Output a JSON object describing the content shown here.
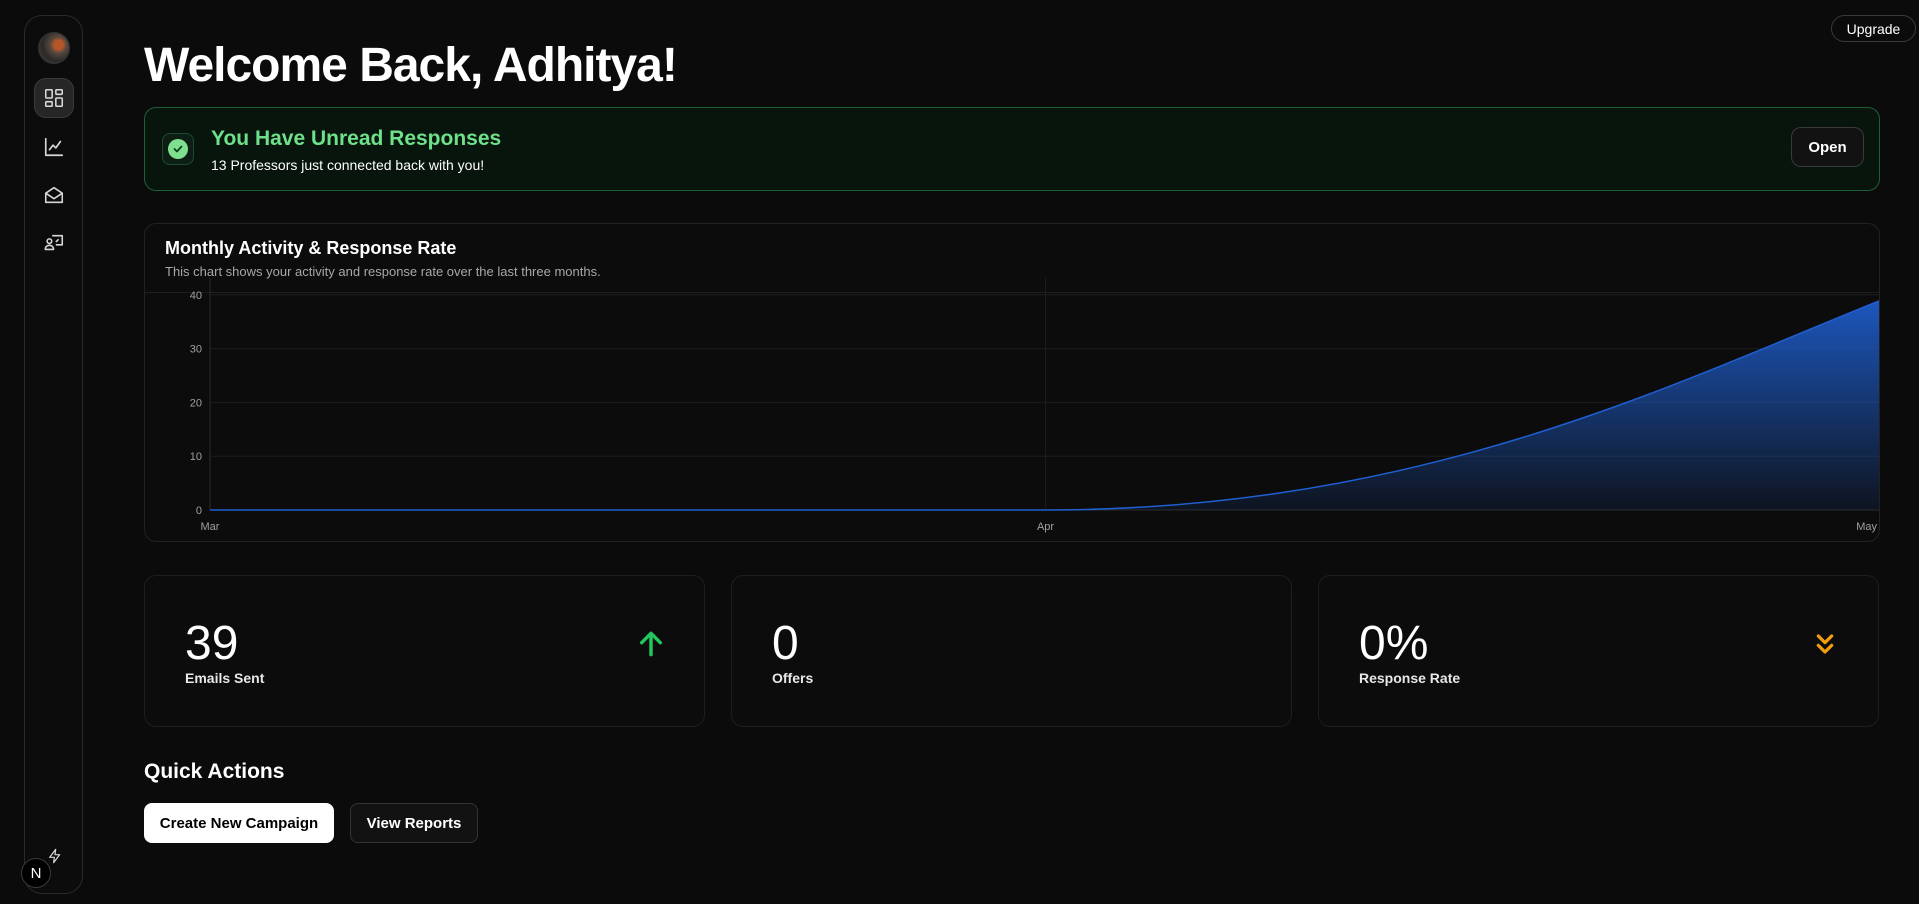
{
  "header": {
    "title": "Welcome Back, Adhitya!",
    "upgrade_label": "Upgrade"
  },
  "sidebar": {
    "items": [
      {
        "name": "dashboard",
        "icon": "dashboard-icon",
        "active": true
      },
      {
        "name": "analytics",
        "icon": "line-chart-icon",
        "active": false
      },
      {
        "name": "inbox",
        "icon": "mail-open-icon",
        "active": false
      },
      {
        "name": "professors",
        "icon": "presentation-user-icon",
        "active": false
      }
    ],
    "footer_icon": "bolt-icon",
    "badge_letter": "N"
  },
  "alert": {
    "title": "You Have Unread Responses",
    "message": "13 Professors just connected back with you!",
    "button_label": "Open",
    "accent_color": "#6ee08a"
  },
  "chart": {
    "title": "Monthly Activity & Response Rate",
    "description": "This chart shows your activity and response rate over the last three months."
  },
  "chart_data": {
    "type": "area",
    "x": [
      "Mar",
      "Apr",
      "May"
    ],
    "series": [
      {
        "values": [
          0,
          0,
          39
        ],
        "color": "#1f5fd1"
      }
    ],
    "y_ticks": [
      0,
      10,
      20,
      30,
      40
    ],
    "ylim": [
      0,
      42
    ],
    "grid": true
  },
  "stats": [
    {
      "value": "39",
      "label": "Emails Sent",
      "icon": "arrow-up-icon",
      "icon_color": "#22c55e"
    },
    {
      "value": "0",
      "label": "Offers",
      "icon": "",
      "icon_color": ""
    },
    {
      "value": "0%",
      "label": "Response Rate",
      "icon": "chevrons-down-icon",
      "icon_color": "#f59e0b"
    }
  ],
  "quick_actions": {
    "title": "Quick Actions",
    "primary_label": "Create New Campaign",
    "secondary_label": "View Reports"
  }
}
